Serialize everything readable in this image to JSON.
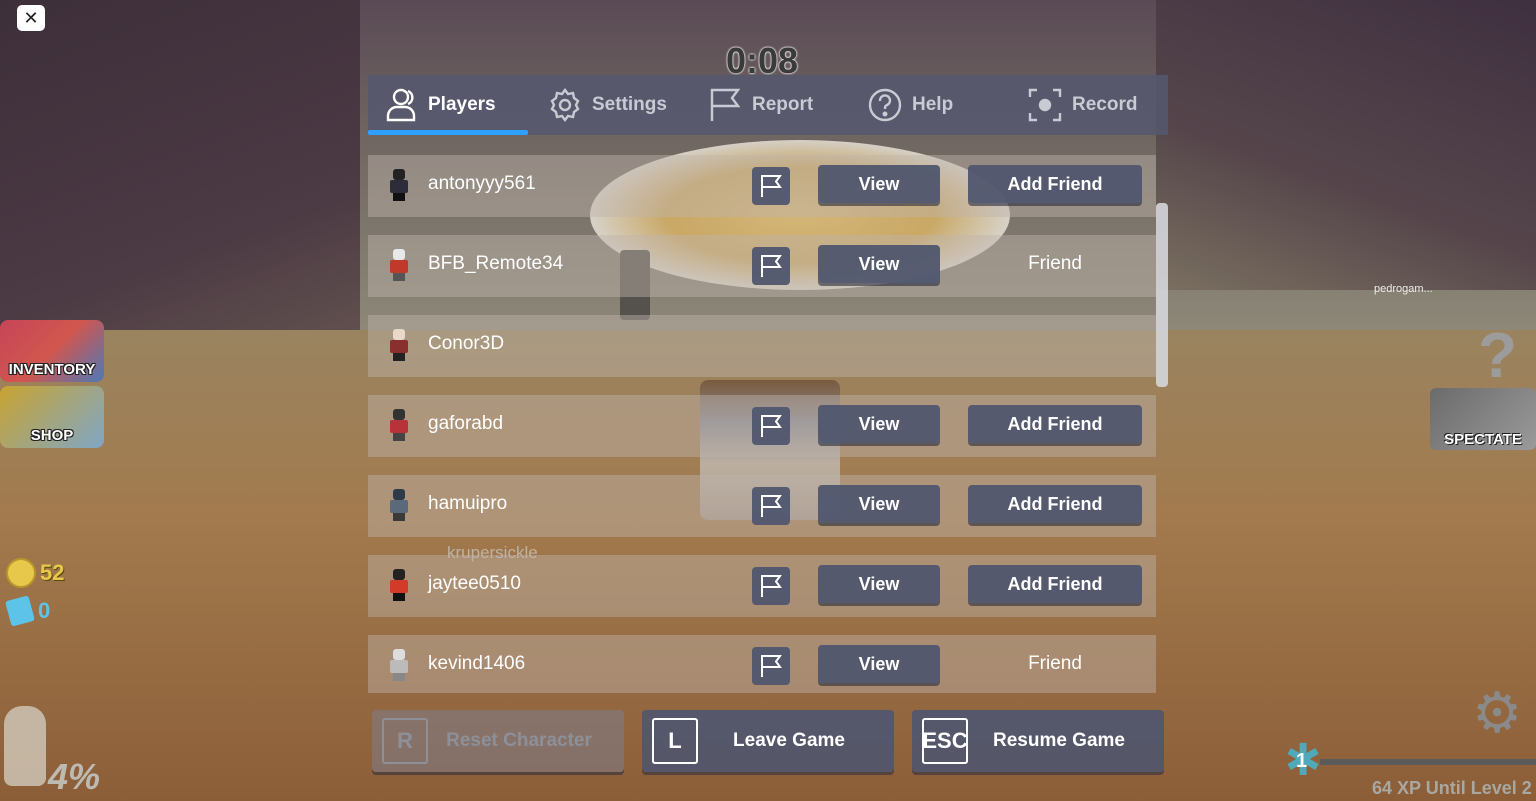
{
  "hud": {
    "close_icon": "✕",
    "timer": "0:08",
    "inventory_label": "INVENTORY",
    "shop_label": "SHOP",
    "coins": "52",
    "tickets": "0",
    "percent": "4%",
    "spectate_label": "SPECTATE",
    "question_mark": "?",
    "level": "1",
    "xp_text": "64 XP Until Level 2",
    "xp_progress": 0,
    "nametag_right": "pedrogam...",
    "ghost_name": "krupersickle"
  },
  "tabs": [
    {
      "label": "Players",
      "icon": "players-icon",
      "active": true
    },
    {
      "label": "Settings",
      "icon": "gear-icon",
      "active": false
    },
    {
      "label": "Report",
      "icon": "flag-icon",
      "active": false
    },
    {
      "label": "Help",
      "icon": "question-icon",
      "active": false
    },
    {
      "label": "Record",
      "icon": "record-icon",
      "active": false
    }
  ],
  "players": [
    {
      "name": "antonyyy561",
      "show_actions": true,
      "friend_state": "Add Friend",
      "is_button": true
    },
    {
      "name": "BFB_Remote34",
      "show_actions": true,
      "friend_state": "Friend",
      "is_button": false
    },
    {
      "name": "Conor3D",
      "show_actions": false,
      "friend_state": "",
      "is_button": false
    },
    {
      "name": "gaforabd",
      "show_actions": true,
      "friend_state": "Add Friend",
      "is_button": true
    },
    {
      "name": "hamuipro",
      "show_actions": true,
      "friend_state": "Add Friend",
      "is_button": true
    },
    {
      "name": "jaytee0510",
      "show_actions": true,
      "friend_state": "Add Friend",
      "is_button": true
    },
    {
      "name": "kevind1406",
      "show_actions": true,
      "friend_state": "Friend",
      "is_button": false
    }
  ],
  "view_label": "View",
  "bottom_buttons": [
    {
      "key": "R",
      "label": "Reset Character",
      "disabled": true
    },
    {
      "key": "L",
      "label": "Leave Game",
      "disabled": false
    },
    {
      "key": "ESC",
      "label": "Resume Game",
      "disabled": false
    }
  ],
  "colors": {
    "tab_underline": "#2d9fff",
    "panel": "#55586e",
    "button": "#50566e"
  }
}
